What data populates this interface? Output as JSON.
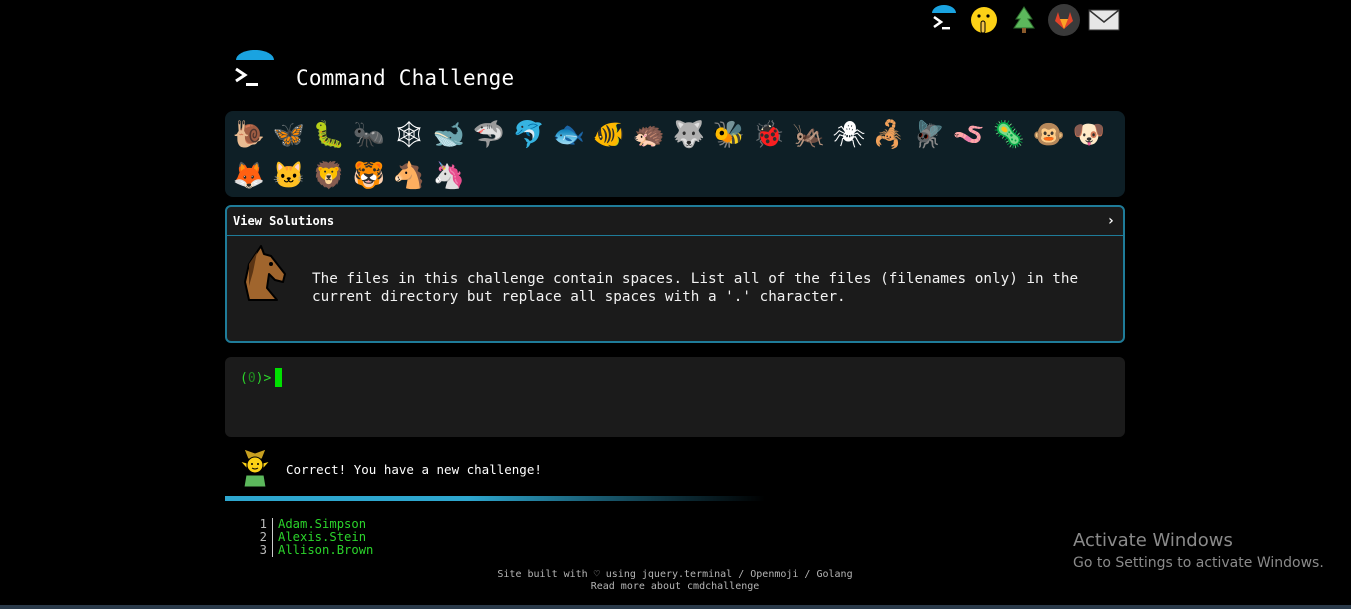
{
  "nav": {
    "items": [
      {
        "name": "terminal-icon"
      },
      {
        "name": "shushing-face-icon"
      },
      {
        "name": "tree-icon"
      },
      {
        "name": "gitlab-icon"
      },
      {
        "name": "mail-icon"
      }
    ]
  },
  "header": {
    "title": "Command Challenge"
  },
  "animals": [
    "🐌",
    "🦋",
    "🐛",
    "🐜",
    "🕸",
    "🐋",
    "🦈",
    "🐬",
    "🐟",
    "🐠",
    "🦔",
    "🐺",
    "🐝",
    "🐞",
    "🦗",
    "🕷",
    "🦂",
    "🪰",
    "🪱",
    "🦠",
    "🐵",
    "🐶",
    "🦊",
    "🐱",
    "🦁",
    "🐯",
    "🐴",
    "🦄"
  ],
  "solutions": {
    "label": "View Solutions",
    "chevron": "›",
    "description": "The files in this challenge contain spaces. List all of the files (filenames only) in the current directory but replace all spaces with a '.' character."
  },
  "terminal": {
    "prompt_open": "(",
    "prompt_count": "0",
    "prompt_close": ")>"
  },
  "feedback": {
    "message": "Correct! You have a new challenge!"
  },
  "files": [
    {
      "num": "1",
      "name": "Adam.Simpson"
    },
    {
      "num": "2",
      "name": "Alexis.Stein"
    },
    {
      "num": "3",
      "name": "Allison.Brown"
    }
  ],
  "footer": {
    "line1": "Site built with ♡ using jquery.terminal / Openmoji / Golang",
    "line2": "Read more about cmdchallenge"
  },
  "watermark": {
    "line1": "Activate Windows",
    "line2": "Go to Settings to activate Windows."
  },
  "colors": {
    "accent": "#1f7c99",
    "prompt": "#2bd42b",
    "bar": "#2ea7cf"
  }
}
